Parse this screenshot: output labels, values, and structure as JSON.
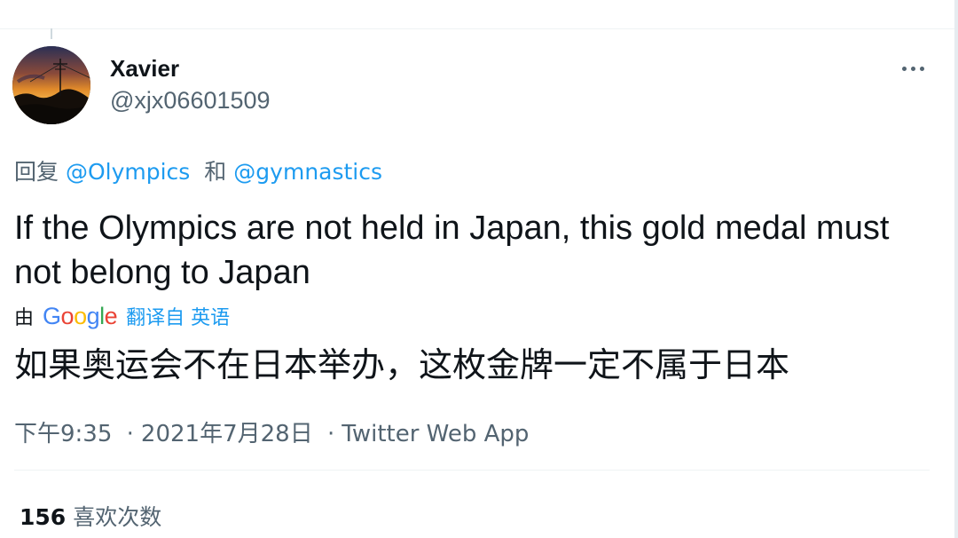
{
  "tweet": {
    "author": {
      "display_name": "Xavier",
      "handle": "@xjx06601509"
    },
    "reply_to": {
      "prefix": "回复",
      "mention_1": "@Olympics",
      "conjunction": "和",
      "mention_2": "@gymnastics"
    },
    "text": "If the Olympics are not held in Japan, this gold medal must not belong to Japan",
    "translation": {
      "by_label": "由",
      "provider_logo_text": "Google",
      "translated_from_label": "翻译自 英语",
      "translated_text": "如果奥运会不在日本举办，这枚金牌一定不属于日本"
    },
    "meta": {
      "time": "下午9:35",
      "separator": "·",
      "date": "2021年7月28日",
      "source": "Twitter Web App"
    },
    "likes": {
      "count": "156",
      "label": "喜欢次数"
    }
  },
  "icons": {
    "more": "more-horizontal-icon",
    "avatar_image": "sunset-landscape-avatar"
  },
  "colors": {
    "text_primary": "#0f1419",
    "text_secondary": "#536471",
    "link_blue": "#1d9bf0",
    "divider": "#eff3f4"
  }
}
